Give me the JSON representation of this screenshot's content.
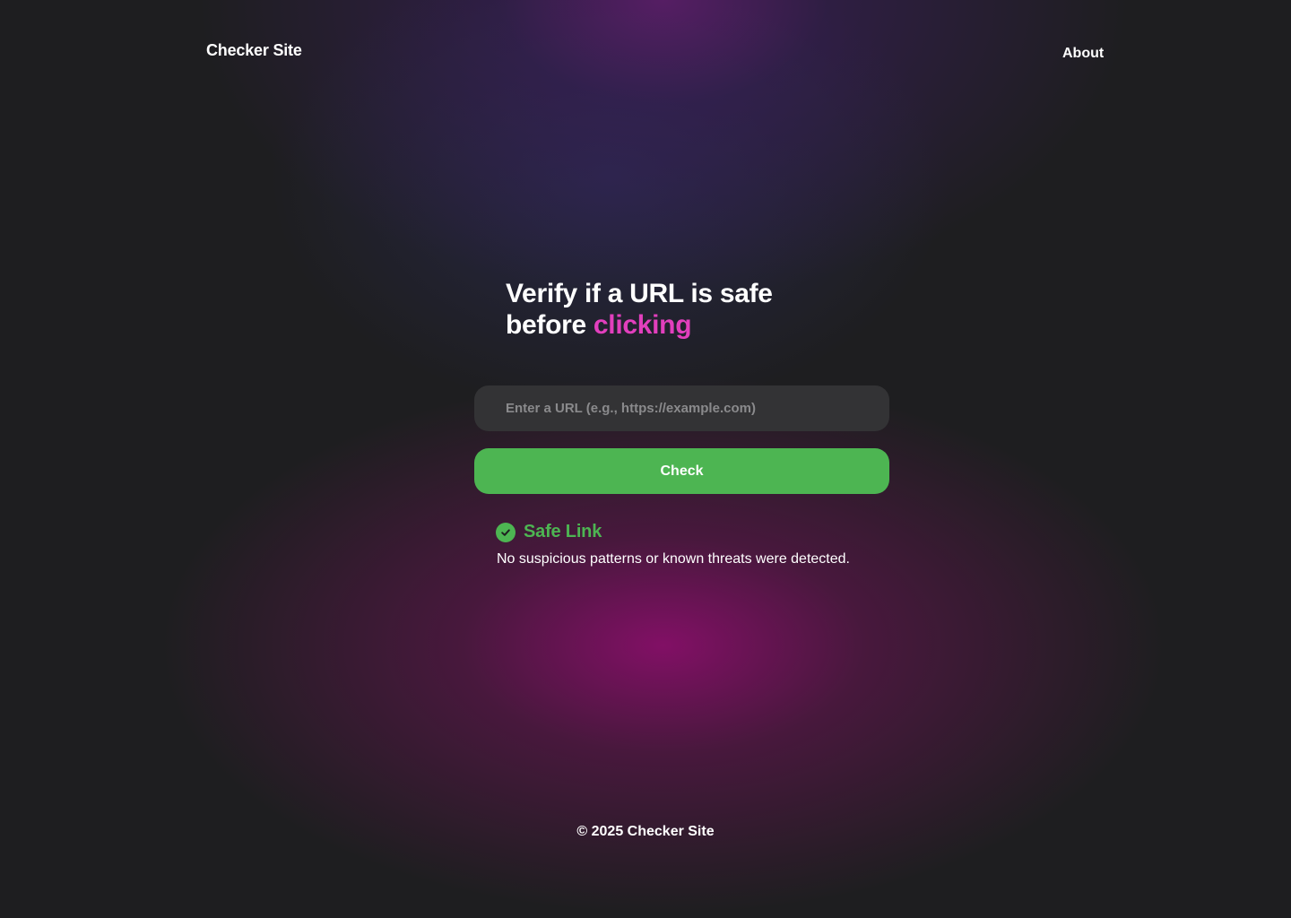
{
  "header": {
    "site_name": "Checker Site",
    "nav_about": "About"
  },
  "hero": {
    "line1": "Verify if a URL is safe",
    "line2_prefix": "before ",
    "line2_accent": "clicking"
  },
  "form": {
    "url_placeholder": "Enter a URL (e.g., https://example.com)",
    "url_value": "",
    "check_label": "Check"
  },
  "result": {
    "icon": "check-circle-icon",
    "status": "Safe Link",
    "description": "No suspicious patterns or known threats were detected."
  },
  "footer": {
    "copyright": "© 2025 Checker Site"
  },
  "colors": {
    "accent_pink": "#e23fbd",
    "safe_green": "#4db552",
    "background": "#1e1e20",
    "input_bg": "#333335"
  }
}
